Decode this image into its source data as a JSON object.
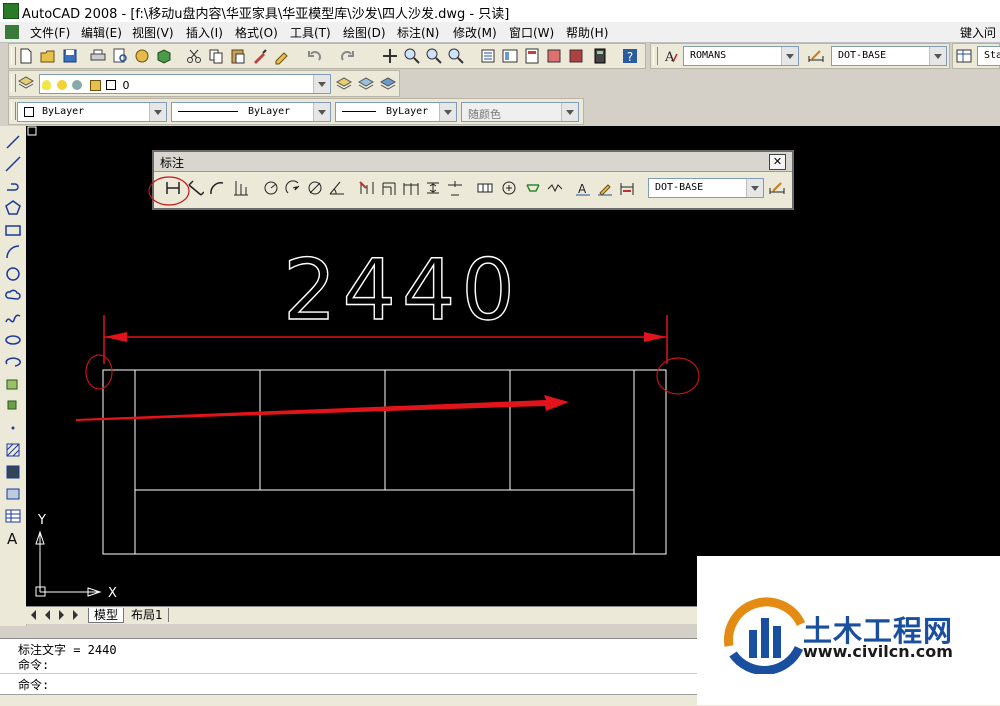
{
  "window": {
    "title": "AutoCAD 2008 - [f:\\移动u盘内容\\华亚家具\\华亚模型库\\沙发\\四人沙发.dwg - 只读]"
  },
  "menu": {
    "items": [
      "文件(F)",
      "编辑(E)",
      "视图(V)",
      "插入(I)",
      "格式(O)",
      "工具(T)",
      "绘图(D)",
      "标注(N)",
      "修改(M)",
      "窗口(W)",
      "帮助(H)"
    ],
    "help_input": "键入问"
  },
  "styles_toolbar": {
    "text_style": "ROMANS",
    "dim_style": "DOT-BASE",
    "table_style": "Sta"
  },
  "layers_toolbar": {
    "current_layer": "0"
  },
  "properties_toolbar": {
    "color": "ByLayer",
    "linetype": "ByLayer",
    "lineweight": "ByLayer",
    "plot_style": "随颜色"
  },
  "dim_toolbar": {
    "title": "标注",
    "close_label": "✕",
    "dim_style": "DOT-BASE"
  },
  "drawing": {
    "dimension_text": "2440",
    "ucs_y": "Y",
    "ucs_x": "X",
    "background": "#000000",
    "line_color": "#ffffff",
    "annotation_color": "#e0141a"
  },
  "layout_tabs": {
    "model": "模型",
    "layout1": "布局1"
  },
  "command_window": {
    "lines": [
      "标注文字 = 2440",
      "命令:",
      "命令:"
    ]
  },
  "watermark": {
    "brand": "土木工程网",
    "url": "www.civilcn.com",
    "brand_color": "#1a4fa0",
    "accent_color": "#e38b12"
  }
}
